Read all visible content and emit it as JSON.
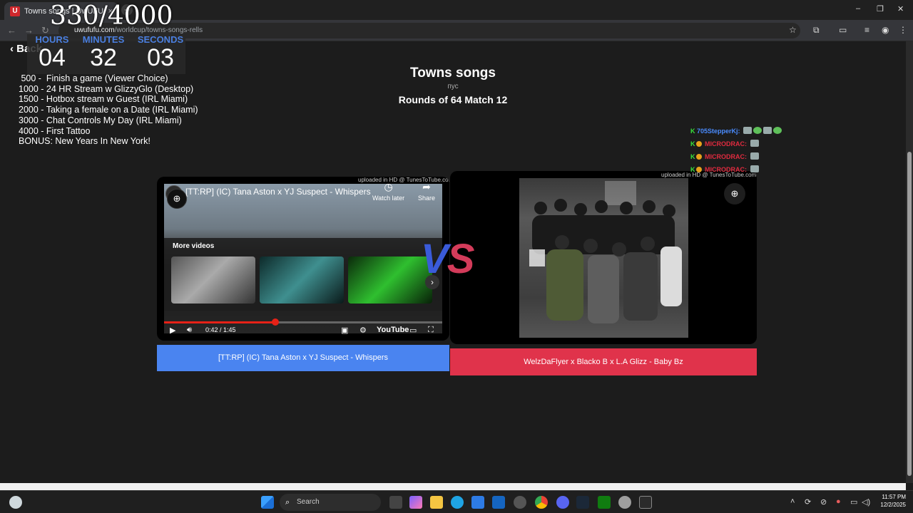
{
  "browser": {
    "tab_title": "Towns songs | UwUFUFU",
    "tab_close": "×",
    "new_tab": "+",
    "url_host": "uwufufu.com",
    "url_path": "/worldcup/towns-songs-rells",
    "window_controls": [
      "–",
      "❐",
      "✕"
    ]
  },
  "page": {
    "back_label": "Back",
    "title": "Towns songs",
    "subtitle": "пус",
    "round": "Rounds of 64 Match 12",
    "left_choice": "[TT:RP] (IC) Tana Aston x YJ Suspect - Whispers",
    "right_choice": "WelzDaFlyer x Blacko B x L.A Glizz - Baby Bz",
    "vs_v": "V",
    "vs_s": "S",
    "uploaded_note": "uploaded in HD @ TunesToTube.com"
  },
  "youtube": {
    "title": "[TT:RP] (IC) Tana Aston x YJ Suspect - Whispers",
    "watch_later": "Watch later",
    "share": "Share",
    "more_videos": "More videos",
    "time": "0:42 / 1:45",
    "brand": "YouTube",
    "progress": 0.4,
    "icons": [
      "play-icon",
      "volume-icon",
      "captions-icon",
      "settings-icon",
      "cast-icon",
      "fullscreen-icon"
    ]
  },
  "overlay": {
    "counter": "330/4000",
    "hours_label": "HOURS",
    "minutes_label": "MINUTES",
    "seconds_label": "SECONDS",
    "hours": "04",
    "minutes": "32",
    "seconds": "03",
    "goals": [
      " 500 -  Finish a game (Viewer Choice)",
      "1000 - 24 HR Stream w GlizzyGlo (Desktop)",
      "1500 - Hotbox stream w Guest (IRL Miami)",
      "2000 - Taking a female on a Date (IRL Miami)",
      "3000 - Chat Controls My Day (IRL Miami)",
      "4000 - First Tattoo",
      "BONUS: New Years In New York!"
    ]
  },
  "chat": [
    {
      "user": "705StepperKj:",
      "color": "#4a8cff"
    },
    {
      "user": "MICRODRAC:",
      "color": "#e02b3f"
    },
    {
      "user": "MICRODRAC:",
      "color": "#e02b3f"
    },
    {
      "user": "MICRODRAC:",
      "color": "#e02b3f"
    }
  ],
  "taskbar": {
    "search_label": "Search",
    "time": "11:57 PM",
    "date": "12/2/2025"
  }
}
